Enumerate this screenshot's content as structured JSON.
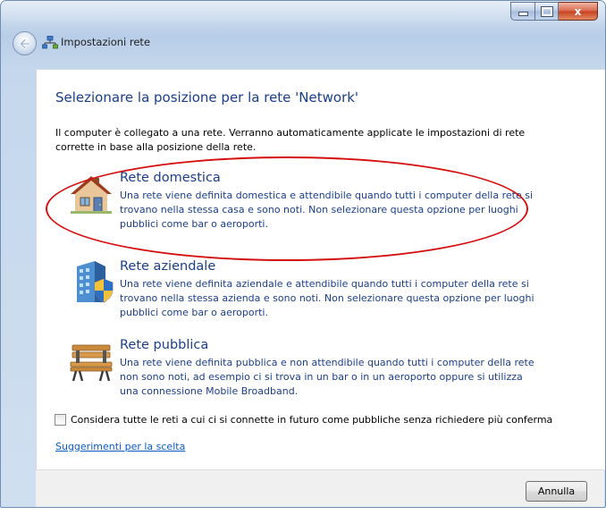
{
  "window": {
    "title": "Impostazioni rete",
    "caption_buttons": [
      "minimize-icon",
      "maximize-icon",
      "close-icon"
    ],
    "close_glyph": "x"
  },
  "content": {
    "heading": "Selezionare la posizione per la rete 'Network'",
    "intro": "Il computer è collegato a una rete. Verranno automaticamente applicate le impostazioni di rete corrette in base alla posizione della rete.",
    "options": [
      {
        "title": "Rete domestica",
        "description": "Una rete viene definita domestica e attendibile quando tutti i computer della rete si trovano nella stessa casa e sono noti. Non selezionare questa opzione per luoghi pubblici come bar o aeroporti.",
        "icon": "house-icon",
        "highlighted": true
      },
      {
        "title": "Rete aziendale",
        "description": "Una rete viene definita aziendale e attendibile quando tutti i computer della rete si trovano nella stessa azienda e sono noti. Non selezionare questa opzione per luoghi pubblici come bar o aeroporti.",
        "icon": "office-building-shield-icon",
        "highlighted": false
      },
      {
        "title": "Rete pubblica",
        "description": "Una rete viene definita pubblica e non attendibile quando tutti i computer della rete non sono noti, ad esempio ci si trova in un bar o in un aeroporto oppure si utilizza una connessione Mobile Broadband.",
        "icon": "park-bench-icon",
        "highlighted": false
      }
    ],
    "checkbox_label": "Considera tutte le reti a cui ci si connette in futuro come pubbliche senza richiedere più conferma",
    "checkbox_checked": false,
    "link": "Suggerimenti per la scelta"
  },
  "footer": {
    "cancel_label": "Annulla"
  },
  "colors": {
    "heading": "#1a3e8a",
    "link": "#0b5bc4",
    "highlight_ring": "#d50f0f"
  }
}
